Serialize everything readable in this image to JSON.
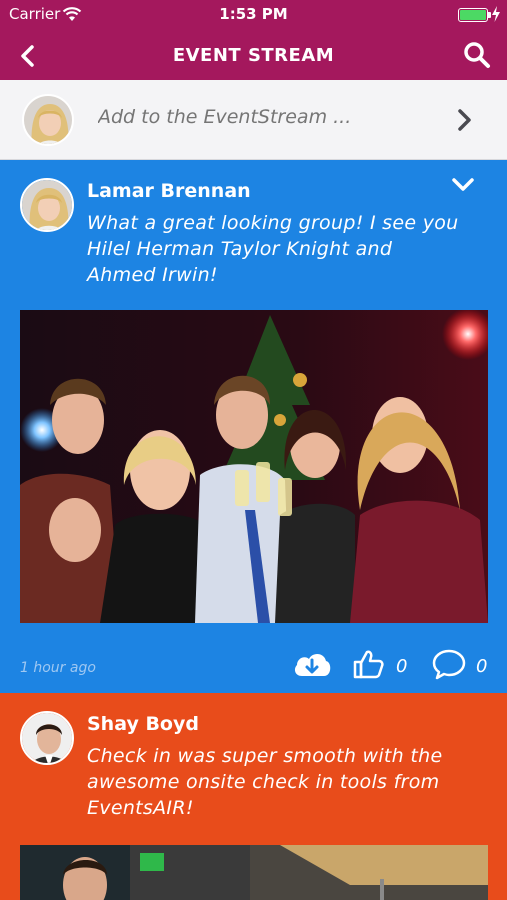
{
  "status_bar": {
    "carrier": "Carrier",
    "time": "1:53 PM"
  },
  "nav": {
    "title": "EVENT STREAM",
    "back_icon": "chevron-left-icon",
    "search_icon": "search-icon"
  },
  "composer": {
    "placeholder": "Add to the EventStream ...",
    "send_icon": "chevron-right-icon"
  },
  "posts": [
    {
      "author": "Lamar Brennan",
      "text_line1": "What a great looking group! I see you",
      "text_line2": "Hilel Herman Taylor Knight and",
      "text_line3": "Ahmed Irwin!",
      "time": "1 hour ago",
      "likes": "0",
      "comments": "0",
      "card_color": "#1d84e3"
    },
    {
      "author": "Shay Boyd",
      "text_line1": "Check in was super smooth with the",
      "text_line2": "awesome onsite check in tools from",
      "text_line3": "EventsAIR!",
      "card_color": "#e84c1b"
    }
  ],
  "colors": {
    "nav_bar": "#a4185d",
    "battery": "#4cd964"
  }
}
